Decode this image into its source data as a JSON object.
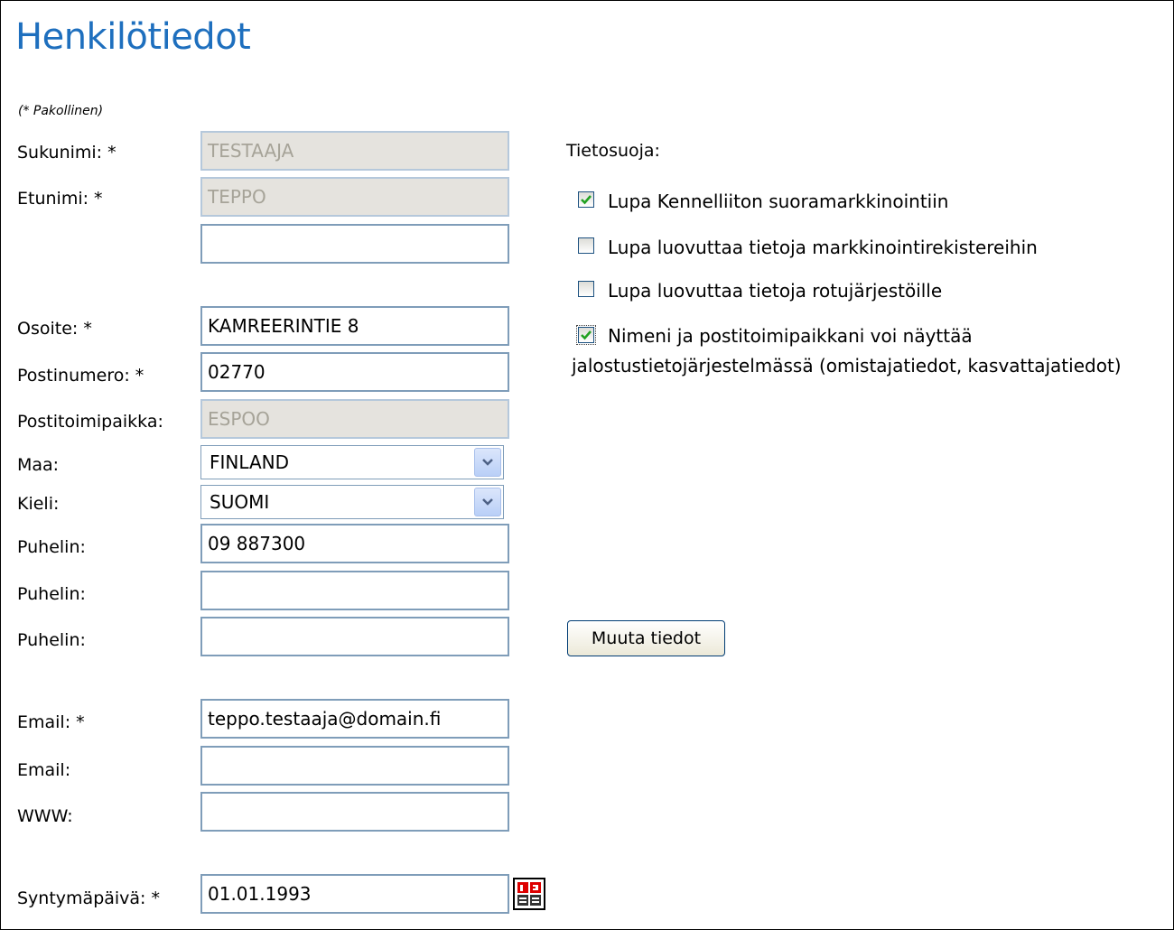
{
  "page": {
    "title": "Henkilötiedot",
    "required_note": "(* Pakollinen)"
  },
  "form": {
    "sukunimi_label": "Sukunimi: *",
    "sukunimi_value": "TESTAAJA",
    "etunimi_label": "Etunimi: *",
    "etunimi_value": "TEPPO",
    "extra_name_value": "",
    "osoite_label": "Osoite: *",
    "osoite_value": "KAMREERINTIE 8",
    "postinumero_label": "Postinumero: *",
    "postinumero_value": "02770",
    "postitoimipaikka_label": "Postitoimipaikka:",
    "postitoimipaikka_value": "ESPOO",
    "maa_label": "Maa:",
    "maa_value": "FINLAND",
    "kieli_label": "Kieli:",
    "kieli_value": "SUOMI",
    "puhelin1_label": "Puhelin:",
    "puhelin1_value": "09 887300",
    "puhelin2_label": "Puhelin:",
    "puhelin2_value": "",
    "puhelin3_label": "Puhelin:",
    "puhelin3_value": "",
    "email1_label": "Email: *",
    "email1_value": "teppo.testaaja@domain.fi",
    "email2_label": "Email:",
    "email2_value": "",
    "www_label": "WWW:",
    "www_value": "",
    "syntymapaiva_label": "Syntymäpäivä: *",
    "syntymapaiva_value": "01.01.1993"
  },
  "privacy": {
    "heading": "Tietosuoja:",
    "options": [
      {
        "label": "Lupa Kennelliiton suoramarkkinointiin",
        "checked": true
      },
      {
        "label": "Lupa luovuttaa tietoja markkinointirekistereihin",
        "checked": false
      },
      {
        "label": "Lupa luovuttaa tietoja rotujärjestöille",
        "checked": false
      },
      {
        "label": "Nimeni ja postitoimipaikkani voi näyttää",
        "checked": true
      }
    ],
    "option4_line2": "jalostustietojärjestelmässä (omistajatiedot, kasvattajatiedot)"
  },
  "actions": {
    "submit_label": "Muuta tiedot"
  },
  "icons": {
    "dropdown": "chevron-down-icon",
    "calendar": "calendar-icon",
    "checkmark": "checkmark-icon"
  },
  "colors": {
    "title": "#1e6fbe",
    "readonly_bg": "#e5e3de",
    "input_border": "#7f9db9",
    "check": "#21a121"
  }
}
